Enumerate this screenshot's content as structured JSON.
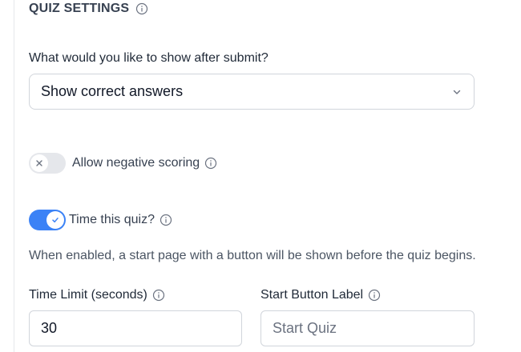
{
  "section": {
    "title": "QUIZ SETTINGS"
  },
  "after_submit": {
    "label": "What would you like to show after submit?",
    "selected": "Show correct answers"
  },
  "negative_scoring": {
    "label": "Allow negative scoring",
    "enabled": false
  },
  "time_quiz": {
    "label": "Time this quiz?",
    "enabled": true,
    "help": "When enabled, a start page with a button will be shown before the quiz begins."
  },
  "time_limit": {
    "label": "Time Limit (seconds)",
    "value": "30"
  },
  "start_button": {
    "label": "Start Button Label",
    "placeholder": "Start Quiz"
  },
  "colors": {
    "accent": "#3b82f6",
    "toggle_off": "#e5e7eb",
    "border": "#d1d5db"
  }
}
